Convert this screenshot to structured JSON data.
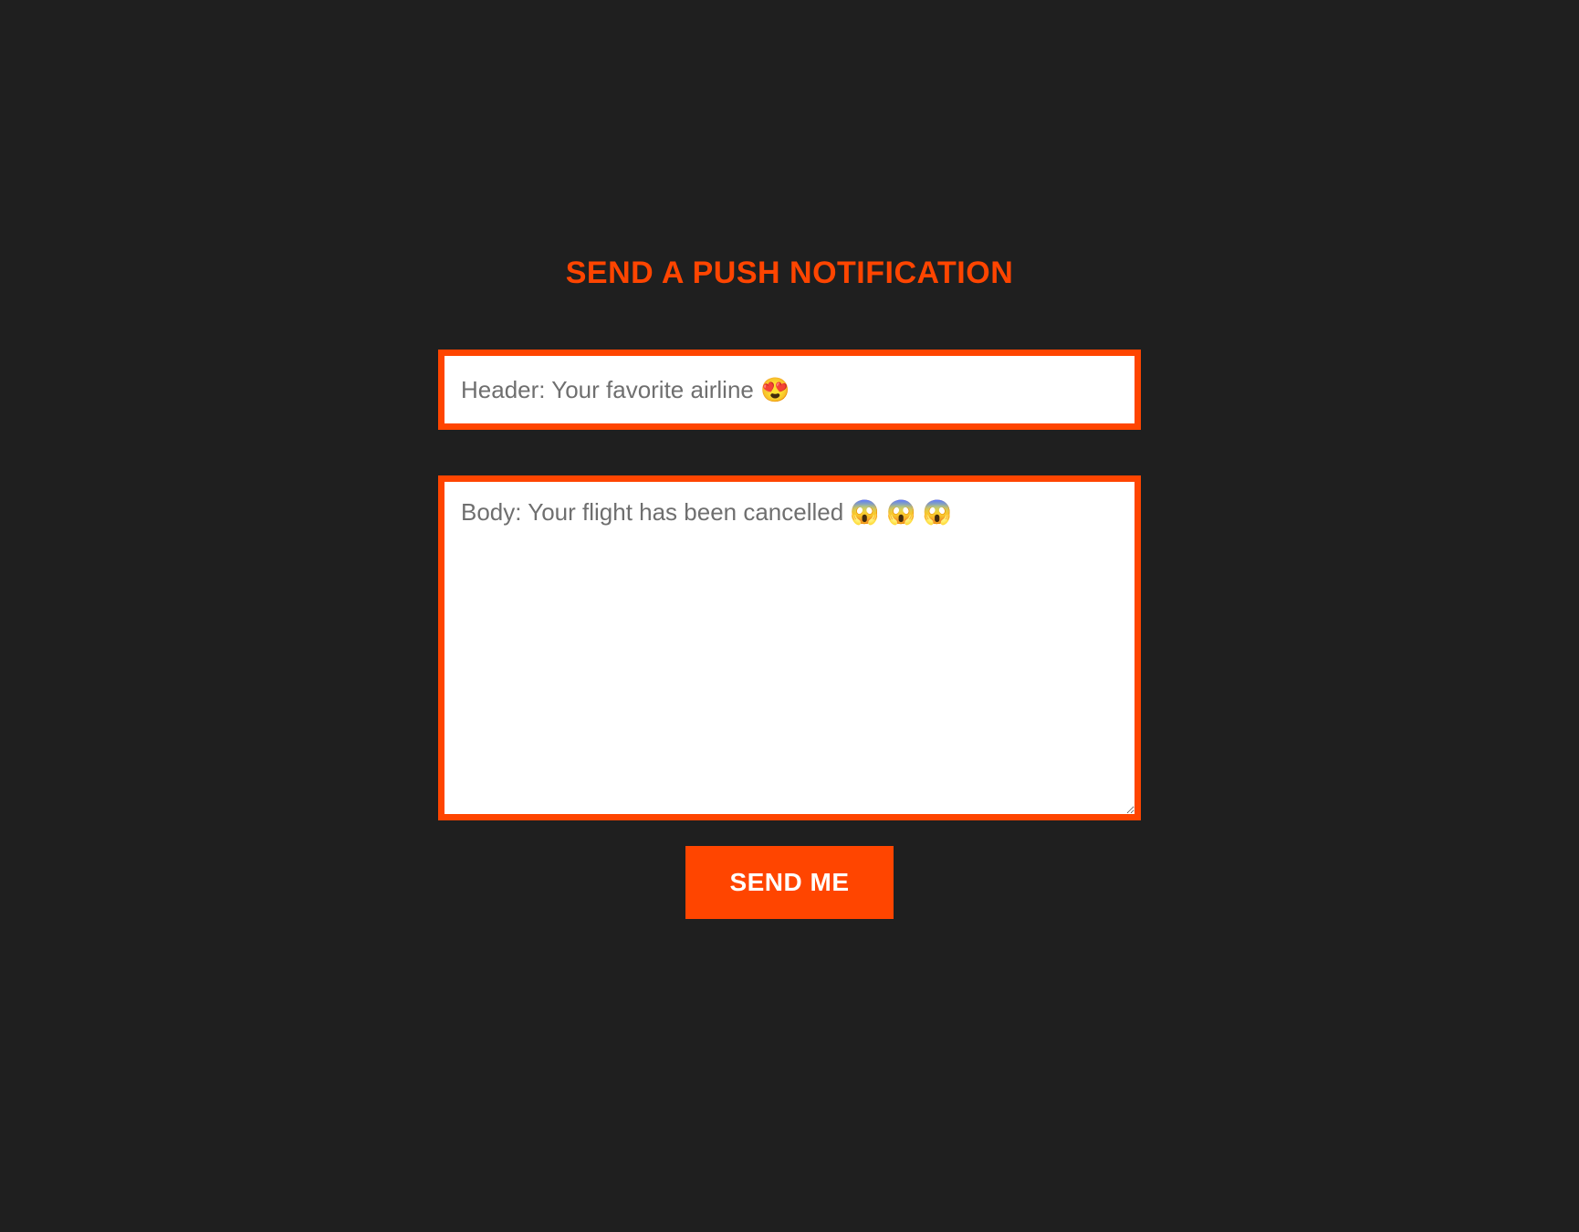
{
  "form": {
    "title": "SEND A PUSH NOTIFICATION",
    "header_input": {
      "value": "",
      "placeholder": "Header: Your favorite airline 😍"
    },
    "body_textarea": {
      "value": "",
      "placeholder": "Body: Your flight has been cancelled 😱 😱 😱"
    },
    "submit_label": "SEND ME"
  },
  "colors": {
    "background": "#1f1f1f",
    "accent": "#ff4500",
    "input_bg": "#ffffff",
    "placeholder": "#6f6f6f"
  }
}
